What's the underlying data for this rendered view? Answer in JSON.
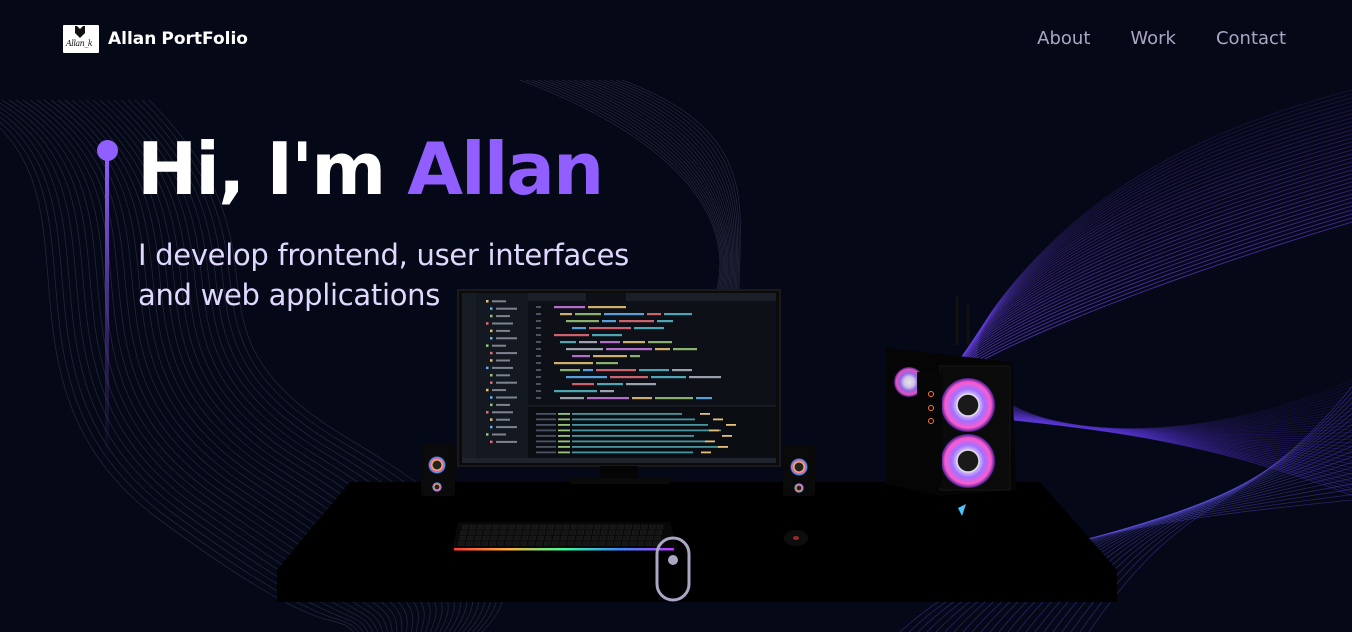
{
  "navbar": {
    "logo_signature": "Allan_k",
    "brand_first": "Allan",
    "brand_second": "PortFolio",
    "links": [
      {
        "label": "About"
      },
      {
        "label": "Work"
      },
      {
        "label": "Contact"
      }
    ]
  },
  "hero": {
    "greeting": "Hi, I'm",
    "name": "Allan",
    "subtitle": "I develop frontend, user interfaces and web applications"
  },
  "colors": {
    "background": "#050816",
    "accent": "#915eff",
    "nav_text": "#aaa6c3",
    "subtitle_text": "#dfd9ff"
  },
  "scene": {
    "description_icons": [
      "desk",
      "monitor",
      "keyboard",
      "mouse",
      "speaker",
      "pc-tower"
    ]
  },
  "scroll": {
    "icon": "mouse-scroll-icon"
  }
}
